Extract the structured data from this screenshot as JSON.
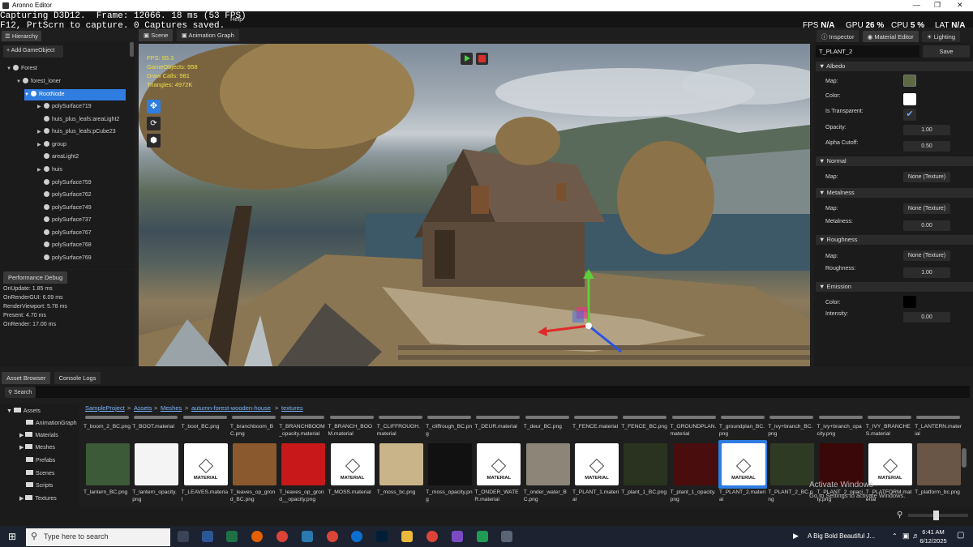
{
  "window": {
    "title": "Aronno Editor"
  },
  "capture_overlay": {
    "line1": "Capturing D3D12.  Frame: 12066. 18 ms (53 FPS)",
    "line2": "F12, PrtScrn to capture. 0 Captures saved.",
    "menu_tail": "Help"
  },
  "top_stats": {
    "fps_label": "FPS",
    "fps_value": "N/A",
    "gpu_label": "GPU",
    "gpu_value": "26 %",
    "cpu_label": "CPU",
    "cpu_value": "5 %",
    "lat_label": "LAT",
    "lat_value": "N/A"
  },
  "hierarchy": {
    "tab": "Hierarchy",
    "add_button": "+ Add GameObject",
    "items": [
      {
        "label": "Forest"
      },
      {
        "label": "forest_loner"
      },
      {
        "label": "RootNode"
      },
      {
        "label": "polySurface719"
      },
      {
        "label": "huis_plus_leafs:areaLight2"
      },
      {
        "label": "huis_plus_leafs:pCube23"
      },
      {
        "label": "group"
      },
      {
        "label": "areaLight2"
      },
      {
        "label": "huis"
      },
      {
        "label": "polySurface759"
      },
      {
        "label": "polySurface762"
      },
      {
        "label": "polySurface749"
      },
      {
        "label": "polySurface737"
      },
      {
        "label": "polySurface767"
      },
      {
        "label": "polySurface768"
      },
      {
        "label": "polySurface769"
      }
    ]
  },
  "performance": {
    "tab": "Performance Debug",
    "lines": [
      "OnUpdate: 1.85 ms",
      "OnRenderGUI: 6.09 ms",
      "RenderViewport: 5.78 ms",
      "Present: 4.70 ms",
      "OnRender: 17.00 ms"
    ]
  },
  "viewport": {
    "tabs": [
      "Scene",
      "Animation Graph"
    ],
    "overlay_lines": [
      "FPS: 55.3",
      "GameObjects: 958",
      "Draw Calls: 981",
      "Triangles: 4972K"
    ]
  },
  "inspector": {
    "tabs": [
      "Inspector",
      "Material Editor",
      "Lighting"
    ],
    "name_value": "T_PLANT_2",
    "save_label": "Save",
    "sections": {
      "albedo": "Albedo",
      "normal": "Normal",
      "metalness": "Metalness",
      "roughness": "Roughness",
      "emission": "Emission"
    },
    "albedo": {
      "map": "Map:",
      "color": "Color:",
      "transparent": "Is Transparent:",
      "opacity": "Opacity:",
      "opacity_value": "1.00",
      "alpha": "Alpha Cutoff:",
      "alpha_value": "0.50"
    },
    "normal": {
      "map": "Map:",
      "map_value": "None (Texture)"
    },
    "metal": {
      "map": "Map:",
      "map_value": "None (Texture)",
      "metalness": "Metalness:",
      "metalness_value": "0.00"
    },
    "rough": {
      "map": "Map:",
      "map_value": "None (Texture)",
      "roughness": "Roughness:",
      "roughness_value": "1.00"
    },
    "emission": {
      "color": "Color:",
      "intensity": "Intensity:",
      "intensity_value": "0.00"
    },
    "colors": {
      "albedo": "#ffffff",
      "emission": "#000000",
      "accent": "#2f7de1"
    }
  },
  "asset_browser": {
    "tabs": [
      "Asset Browser",
      "Console Logs"
    ],
    "search_label": "Search",
    "breadcrumb": [
      "SampleProject",
      "Assets",
      "Meshes",
      "autumn-forest-wooden-house",
      "textures"
    ],
    "folders": [
      "Assets",
      "AnimationGraph",
      "Materials",
      "Meshes",
      "Prefabs",
      "Scenes",
      "Scripts",
      "Textures"
    ],
    "row1": [
      "T_boom_2_BC.png",
      "T_BOOT.material",
      "T_boot_BC.png",
      "T_branchboom_BC.png",
      "T_BRANCHBOOM_opacity.material",
      "T_BRANCH_BOOM.material",
      "T_CLIFFROUGH.material",
      "T_cliffrough_BC.png",
      "T_DEUR.material",
      "T_deur_BC.png",
      "T_FENCE.material",
      "T_FENCE_BC.png",
      "T_GROUNDPLAN.material",
      "T_groundplan_BC.png",
      "T_ivy+branch_BC.png",
      "T_ivy+branch_opacity.png",
      "T_IVY_BRANCHES.material",
      "T_LANTERN.material"
    ],
    "row2": [
      "T_lantern_BC.png",
      "T_lantern_opacity.png",
      "T_LEAVES.material",
      "T_leaves_op_grond_BC.png",
      "T_leaves_op_grond__opacity.png",
      "T_MOSS.material",
      "T_moss_bc.png",
      "T_moss_opacity.png",
      "T_ONDER_WATER.material",
      "T_onder_water_BC.png",
      "T_PLANT_1.material",
      "T_plant_1_BC.png",
      "T_plant_1_opacity.png",
      "T_PLANT_2.material",
      "T_PLANT_2_BC.png",
      "T_PLANT_2_opacity.png",
      "T_PLATFORM.material",
      "T_platform_bc.png"
    ],
    "material_badge": "MATERIAL"
  },
  "watermark": {
    "line1": "Activate Windows",
    "line2": "Go to Settings to activate Windows."
  },
  "taskbar": {
    "search_placeholder": "Type here to search",
    "now_playing": "A Big Bold Beautiful J...",
    "time": "6:41 AM",
    "date": "6/12/2025"
  }
}
